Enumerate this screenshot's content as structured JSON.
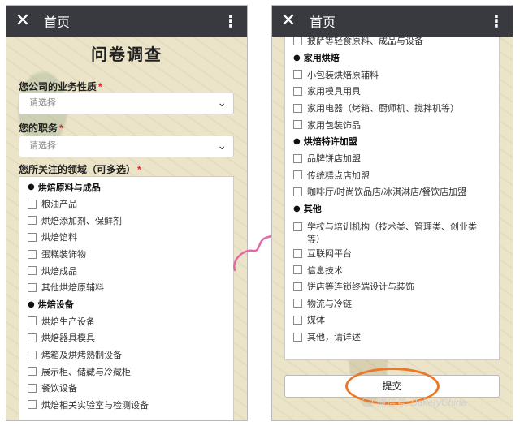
{
  "header": {
    "title": "首页"
  },
  "left": {
    "page_title": "问卷调查",
    "business_label": "您公司的业务性质",
    "business_placeholder": "请选择",
    "position_label": "您的职务",
    "position_placeholder": "请选择",
    "areas_label": "您所关注的领域（可多选）",
    "sections": [
      {
        "title": "烘焙原料与成品",
        "items": [
          "粮油产品",
          "烘焙添加剂、保鲜剂",
          "烘焙馅料",
          "蛋糕装饰物",
          "烘焙成品",
          "其他烘焙原辅料"
        ]
      },
      {
        "title": "烘焙设备",
        "items": [
          "烘焙生产设备",
          "烘焙器具模具",
          "烤箱及烘烤熟制设备",
          "展示柜、储藏与冷藏柜",
          "餐饮设备",
          "烘焙相关实验室与检测设备"
        ]
      }
    ]
  },
  "right": {
    "partial_item": "披萨等轻食原料、成品与设备",
    "sections": [
      {
        "title": "家用烘焙",
        "items": [
          "小包装烘焙原辅料",
          "家用模具用具",
          "家用电器（烤箱、厨师机、搅拌机等）",
          "家用包装饰品"
        ]
      },
      {
        "title": "烘焙特许加盟",
        "items": [
          "品牌饼店加盟",
          "传统糕点店加盟",
          "咖啡厅/时尚饮品店/冰淇淋店/餐饮店加盟"
        ]
      },
      {
        "title": "其他",
        "items": [
          "学校与培训机构（技术类、管理类、创业类等）",
          "互联网平台",
          "信息技术",
          "饼店等连锁终端设计与装饰",
          "物流与冷链",
          "媒体",
          "其他，请详述"
        ]
      }
    ],
    "submit_label": "提交",
    "watermark": "微信号: BakeryChina"
  },
  "colors": {
    "topbar": "#393a3f",
    "required": "#d23333",
    "highlight_ring": "#e8782a",
    "arrow": "#e26aa8"
  },
  "icons": {
    "close": "close-icon",
    "more": "more-vertical-icon",
    "dropdown": "chevron-down-icon",
    "arrow": "curved-arrow-icon"
  }
}
